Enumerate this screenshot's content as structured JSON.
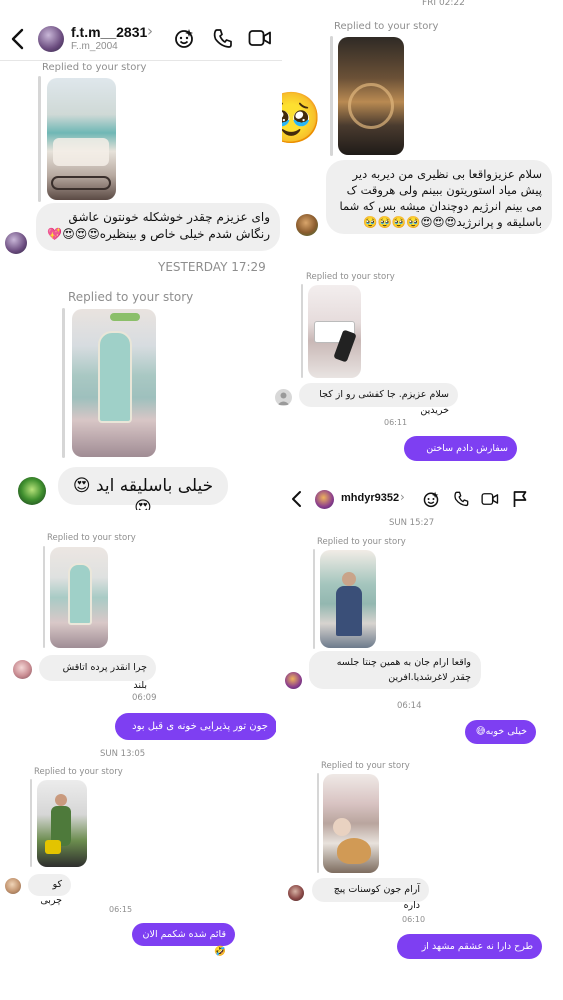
{
  "header1": {
    "username": "f.t.m__2831",
    "subtitle": "F..m_2004",
    "chevron": "›",
    "icons": [
      "back-icon",
      "effects-icon",
      "phone-icon",
      "video-icon"
    ]
  },
  "panelA": {
    "replied": "Replied to your story",
    "message": "وای عزیزم چقدر خوشکله خونتون عاشق رنگاش شدم خیلی خاص و بینظیره😍😍😍💖"
  },
  "panelTR": {
    "date": "FRI 02:22",
    "replied": "Replied to your story",
    "big_emoji": "🥹",
    "message": "سلام عزیزواقعا بی نظیری من دیربه دیر پیش میاد استوریتون ببینم ولی هروقت ک می بینم انرژیم دوچندان میشه بس که شما باسلیقه و پرانرژید😍😍😍🥹🥹🥹🥹"
  },
  "panelB": {
    "date": "YESTERDAY 17:29",
    "replied": "Replied to your story",
    "message": "خیلی باسلیقه اید 😍😍"
  },
  "panelR2": {
    "replied": "Replied to your story",
    "message": "سلام عزیزم. جا کفشی رو از کجا خریدین",
    "time": "06:11",
    "reply": "سفارش دادم ساختن عزیزم"
  },
  "header2": {
    "username": "mhdyr9352",
    "chevron": "›",
    "icons": [
      "back-icon",
      "effects-icon",
      "phone-icon",
      "video-icon",
      "flag-icon"
    ]
  },
  "panelC": {
    "replied": "Replied to your story",
    "message": "چرا انقدر پرده اتاقش بلند",
    "time": "06:09",
    "reply": "جون تور پذیرایی خونه ی قبل بود😅"
  },
  "panelR3": {
    "date": "SUN 15:27",
    "replied": "Replied to your story",
    "message": "واقعا ارام جان به همین چنتا جلسه چقدر لاغرشدیا.افرین",
    "time": "06:14",
    "reply": "خیلی خوبه😅"
  },
  "panelD": {
    "date": "SUN 13:05",
    "replied": "Replied to your story",
    "message": "کو چربی",
    "time": "06:15",
    "reply": "قائم شده شکمم الان🤣"
  },
  "panelR4": {
    "replied": "Replied to your story",
    "message": "آرام جون کوسنات پیچ داره",
    "time": "06:10",
    "reply": "طرح دارا نه عشقم مشهد از پروما"
  },
  "colors": {
    "accent": "#7e3ff2",
    "bubble": "#efefef",
    "meta": "#8e8e8e"
  }
}
